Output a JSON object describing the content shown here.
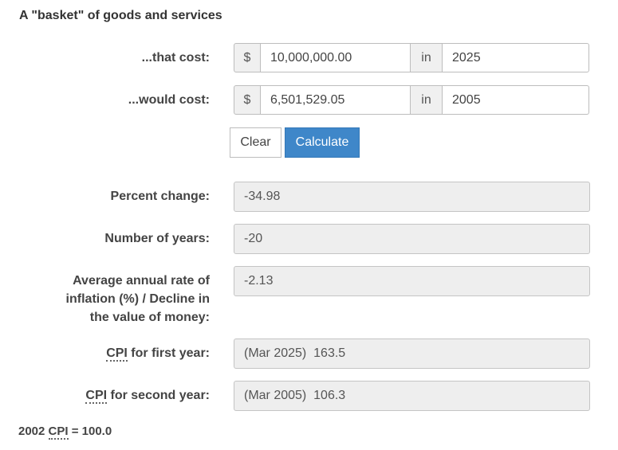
{
  "heading": "A \"basket\" of goods and services",
  "row1": {
    "label": "...that cost:",
    "currency": "$",
    "amount": "10,000,000.00",
    "in_label": "in",
    "year": "2025"
  },
  "row2": {
    "label": "...would cost:",
    "currency": "$",
    "amount": "6,501,529.05",
    "in_label": "in",
    "year": "2005"
  },
  "buttons": {
    "clear": "Clear",
    "calculate": "Calculate"
  },
  "results": {
    "percent_change": {
      "label": "Percent change:",
      "value": "-34.98"
    },
    "number_of_years": {
      "label": "Number of years:",
      "value": "-20"
    },
    "avg_rate": {
      "label_line1": "Average annual rate of",
      "label_line2": "inflation (%) / Decline in",
      "label_line3": "the value of money:",
      "value": "-2.13"
    },
    "cpi_first": {
      "abbr": "CPI",
      "label_rest": " for first year:",
      "value": "(Mar 2025)  163.5"
    },
    "cpi_second": {
      "abbr": "CPI",
      "label_rest": " for second year:",
      "value": "(Mar 2005)  106.3"
    }
  },
  "footer": {
    "prefix": "2002 ",
    "abbr": "CPI",
    "suffix": " = 100.0"
  },
  "colors": {
    "calculate_button": "#3f87c9",
    "readonly_background": "#eeeeee"
  }
}
